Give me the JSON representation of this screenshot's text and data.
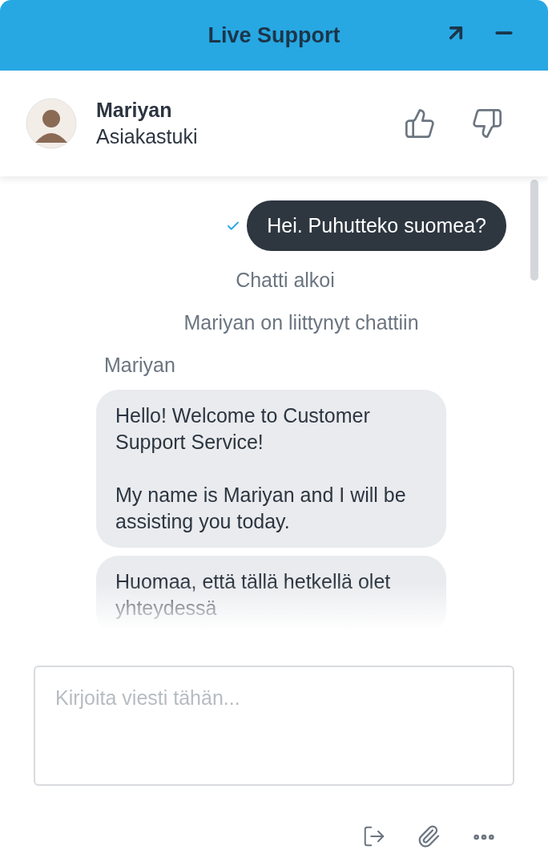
{
  "window": {
    "title": "Live Support"
  },
  "agent": {
    "name": "Mariyan",
    "role": "Asiakastuki"
  },
  "messages": [
    {
      "kind": "outgoing",
      "text": "Hei. Puhutteko suomea?",
      "delivered": true
    },
    {
      "kind": "system",
      "text": "Chatti alkoi"
    },
    {
      "kind": "system",
      "text": "Mariyan on liittynyt chattiin"
    },
    {
      "kind": "sender",
      "text": "Mariyan"
    },
    {
      "kind": "incoming",
      "paragraphs": [
        "Hello! Welcome to Customer Support Service!",
        "My name is Mariyan and I will be assisting you today."
      ]
    },
    {
      "kind": "incoming",
      "paragraphs": [
        "Huomaa, että tällä hetkellä olet yhteydessä"
      ]
    }
  ],
  "composer": {
    "placeholder": "Kirjoita viesti tähän..."
  }
}
